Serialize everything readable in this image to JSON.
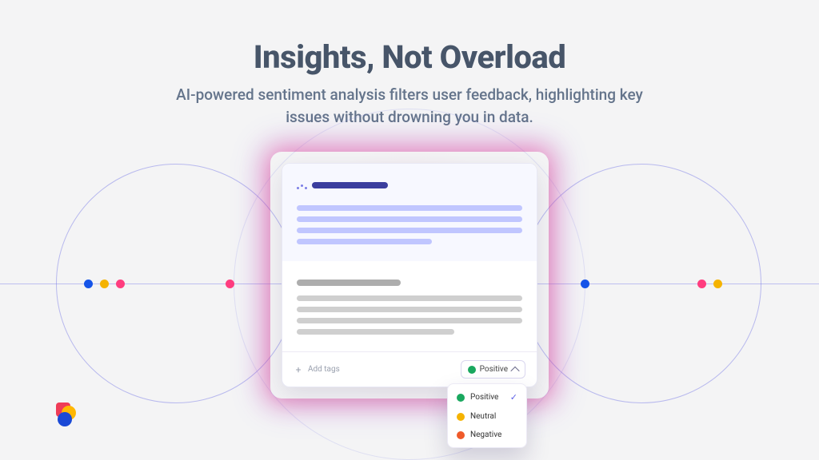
{
  "hero": {
    "title": "Insights, Not Overload",
    "subtitle": "AI-powered sentiment analysis filters user feedback, highlighting key issues without drowning you in data."
  },
  "card": {
    "add_tags_label": "Add tags",
    "sentiment_button": "Positive"
  },
  "dropdown": {
    "items": [
      {
        "label": "Positive",
        "color": "#1aa85f",
        "selected": true
      },
      {
        "label": "Neutral",
        "color": "#f5b301",
        "selected": false
      },
      {
        "label": "Negative",
        "color": "#ef5a2a",
        "selected": false
      }
    ]
  },
  "colors": {
    "pink": "#ff3d7f",
    "yellow": "#f5b301",
    "blue": "#1554e8",
    "indigo": "#6266f1"
  }
}
